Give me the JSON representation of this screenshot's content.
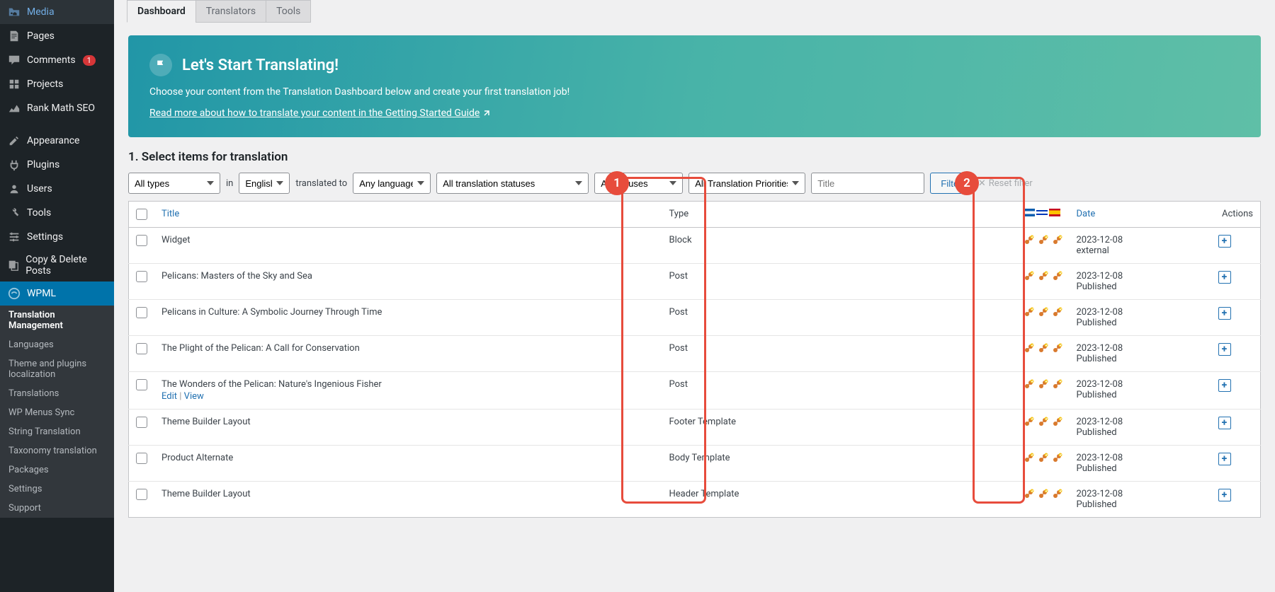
{
  "sidebar": {
    "items": [
      {
        "icon": "media",
        "label": "Media"
      },
      {
        "icon": "pages",
        "label": "Pages"
      },
      {
        "icon": "comments",
        "label": "Comments",
        "badge": "1"
      },
      {
        "icon": "projects",
        "label": "Projects"
      },
      {
        "icon": "rankmath",
        "label": "Rank Math SEO"
      }
    ],
    "items2": [
      {
        "icon": "appearance",
        "label": "Appearance"
      },
      {
        "icon": "plugins",
        "label": "Plugins"
      },
      {
        "icon": "users",
        "label": "Users"
      },
      {
        "icon": "tools",
        "label": "Tools"
      },
      {
        "icon": "settings",
        "label": "Settings"
      },
      {
        "icon": "copy",
        "label": "Copy & Delete Posts"
      }
    ],
    "wpml_label": "WPML",
    "submenu": [
      "Translation Management",
      "Languages",
      "Theme and plugins localization",
      "Translations",
      "WP Menus Sync",
      "String Translation",
      "Taxonomy translation",
      "Packages",
      "Settings",
      "Support"
    ]
  },
  "tabs": {
    "dashboard": "Dashboard",
    "translators": "Translators",
    "tools": "Tools"
  },
  "banner": {
    "title": "Let's Start Translating!",
    "sub": "Choose your content from the Translation Dashboard below and create your first translation job!",
    "link": "Read more about how to translate your content in the Getting Started Guide"
  },
  "section": "1. Select items for translation",
  "filters": {
    "types": "All types",
    "in": "in",
    "lang": "English",
    "translated": "translated to",
    "any": "Any language",
    "tstatus": "All translation statuses",
    "status": "All statuses",
    "priority": "All Translation Priorities",
    "title_ph": "Title",
    "filter": "Filter",
    "reset": "Reset filter"
  },
  "columns": {
    "title": "Title",
    "type": "Type",
    "date": "Date",
    "actions": "Actions"
  },
  "rows": [
    {
      "title": "Widget",
      "type": "Block",
      "date": "2023-12-08",
      "status": "external"
    },
    {
      "title": "Pelicans: Masters of the Sky and Sea",
      "type": "Post",
      "date": "2023-12-08",
      "status": "Published"
    },
    {
      "title": "Pelicans in Culture: A Symbolic Journey Through Time",
      "type": "Post",
      "date": "2023-12-08",
      "status": "Published"
    },
    {
      "title": "The Plight of the Pelican: A Call for Conservation",
      "type": "Post",
      "date": "2023-12-08",
      "status": "Published"
    },
    {
      "title": "The Wonders of the Pelican: Nature's Ingenious Fisher",
      "type": "Post",
      "date": "2023-12-08",
      "status": "Published",
      "actions": true
    },
    {
      "title": "Theme Builder Layout",
      "type": "Footer Template",
      "date": "2023-12-08",
      "status": "Published"
    },
    {
      "title": "Product Alternate",
      "type": "Body Template",
      "date": "2023-12-08",
      "status": "Published"
    },
    {
      "title": "Theme Builder Layout",
      "type": "Header Template",
      "date": "2023-12-08",
      "status": "Published"
    }
  ],
  "row_actions": {
    "edit": "Edit",
    "view": "View"
  },
  "callouts": {
    "1": "1",
    "2": "2"
  }
}
